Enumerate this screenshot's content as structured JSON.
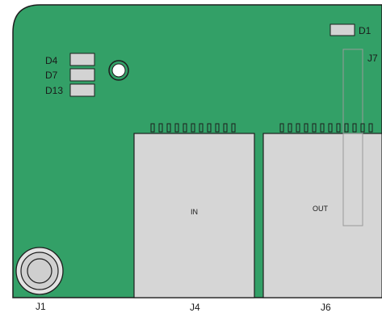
{
  "board": {
    "colors": {
      "pcb": "#33a067",
      "outline": "#1e1e1e",
      "component": "#d3d3d3",
      "connector": "#d6d6d6",
      "background": "#ffffff"
    }
  },
  "leds": {
    "d1": "D1",
    "d4": "D4",
    "d7": "D7",
    "d13": "D13"
  },
  "connectors": {
    "j1": "J1",
    "j4": "J4",
    "j6": "J6",
    "j7": "J7",
    "in_label": "IN",
    "out_label": "OUT"
  }
}
